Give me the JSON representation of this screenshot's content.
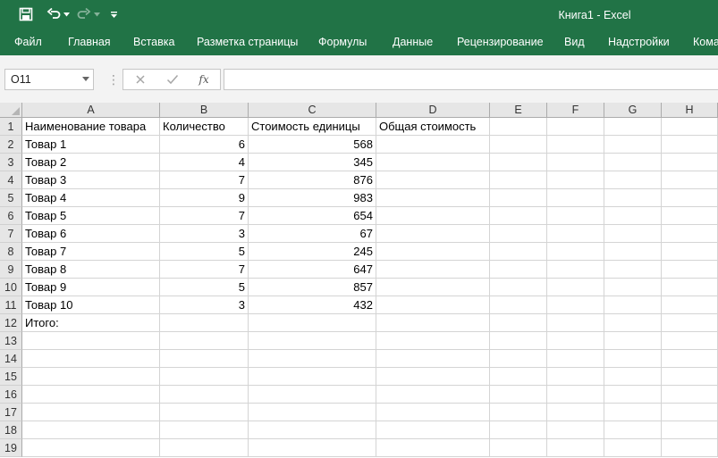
{
  "window": {
    "title": "Книга1 - Excel"
  },
  "ribbon": {
    "tabs": [
      "Файл",
      "Главная",
      "Вставка",
      "Разметка страницы",
      "Формулы",
      "Данные",
      "Рецензирование",
      "Вид",
      "Надстройки",
      "Кома"
    ]
  },
  "formula_bar": {
    "name_box": "O11",
    "fx_label": "fx",
    "content": ""
  },
  "sheet": {
    "columns": [
      "A",
      "B",
      "C",
      "D",
      "E",
      "F",
      "G",
      "H"
    ],
    "rows": [
      "1",
      "2",
      "3",
      "4",
      "5",
      "6",
      "7",
      "8",
      "9",
      "10",
      "11",
      "12",
      "13",
      "14",
      "15",
      "16",
      "17",
      "18",
      "19"
    ],
    "cells": [
      [
        "Наименование товара",
        "Количество",
        "Стоимость единицы",
        "Общая стоимость"
      ],
      [
        "Товар 1",
        "6",
        "568",
        ""
      ],
      [
        "Товар 2",
        "4",
        "345",
        ""
      ],
      [
        "Товар 3",
        "7",
        "876",
        ""
      ],
      [
        "Товар 4",
        "9",
        "983",
        ""
      ],
      [
        "Товар 5",
        "7",
        "654",
        ""
      ],
      [
        "Товар 6",
        "3",
        "67",
        ""
      ],
      [
        "Товар 7",
        "5",
        "245",
        ""
      ],
      [
        "Товар 8",
        "7",
        "647",
        ""
      ],
      [
        "Товар 9",
        "5",
        "857",
        ""
      ],
      [
        "Товар 10",
        "3",
        "432",
        ""
      ],
      [
        "Итого:",
        "",
        "",
        ""
      ]
    ]
  },
  "colors": {
    "accent": "#217346",
    "grid_line": "#d4d4d4",
    "header_bg": "#e6e6e6"
  }
}
